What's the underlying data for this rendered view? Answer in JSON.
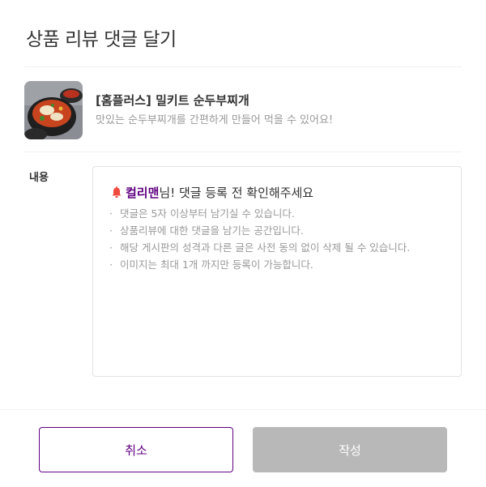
{
  "modal": {
    "title": "상품 리뷰 댓글 달기"
  },
  "product": {
    "name": "[홈플러스] 밀키트 순두부찌개",
    "description": "맛있는 순두부찌개를 간편하게 만들어 먹을 수 있어요!",
    "thumbnail_icon": "food-thumbnail"
  },
  "form": {
    "content_label": "내용",
    "notice": {
      "icon": "bell-icon",
      "username": "컬리맨",
      "title_suffix": "님! 댓글 등록 전 확인해주세요",
      "items": [
        "댓글은 5자 이상부터 남기실 수 있습니다.",
        "상품리뷰에 대한 댓글을 남기는 공간입니다.",
        "해당 게시판의 성격과 다른 글은 사전 동의 없이 삭제 될 수 있습니다.",
        "이미지는 최대 1개 까지만 등록이 가능합니다."
      ]
    }
  },
  "buttons": {
    "cancel_label": "취소",
    "submit_label": "작성"
  },
  "colors": {
    "accent": "#5f0080",
    "disabled": "#b8b8b8",
    "bell": "#f04b3c"
  }
}
